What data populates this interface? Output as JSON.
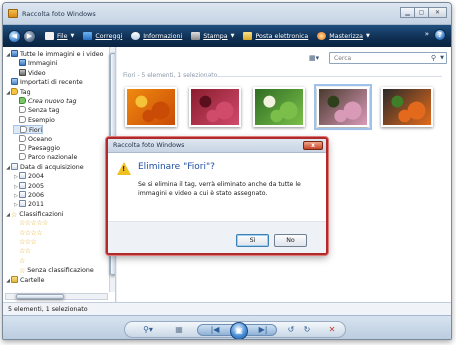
{
  "window": {
    "title": "Raccolta foto Windows"
  },
  "toolbar": {
    "items": [
      {
        "label": "File",
        "icon": "file-icon"
      },
      {
        "label": "Correggi",
        "icon": "fix-icon"
      },
      {
        "label": "Informazioni",
        "icon": "info-icon"
      },
      {
        "label": "Stampa",
        "icon": "print-icon"
      },
      {
        "label": "Posta elettronica",
        "icon": "mail-icon"
      },
      {
        "label": "Masterizza",
        "icon": "burn-icon"
      }
    ],
    "more": "»",
    "help": "?"
  },
  "sidebar": {
    "rows": [
      {
        "label": "Tutte le immagini e i video",
        "exp": "◢",
        "icon": "ico-photo"
      },
      {
        "label": "Immagini",
        "exp": "",
        "icon": "ico-photo"
      },
      {
        "label": "Video",
        "exp": "",
        "icon": "ico-video"
      },
      {
        "label": "Importati di recente",
        "exp": "",
        "icon": "ico-recent"
      },
      {
        "label": "Tag",
        "exp": "◢",
        "icon": "ico-tag"
      },
      {
        "label": "Crea nuovo tag",
        "exp": "",
        "icon": "ico-tag-new",
        "italic": true
      },
      {
        "label": "Senza tag",
        "exp": "",
        "icon": "ico-tag-empty"
      },
      {
        "label": "Esempio",
        "exp": "",
        "icon": "ico-tag-empty"
      },
      {
        "label": "Fiori",
        "exp": "",
        "icon": "ico-tag-empty",
        "selected": true
      },
      {
        "label": "Oceano",
        "exp": "",
        "icon": "ico-tag-empty"
      },
      {
        "label": "Paesaggio",
        "exp": "",
        "icon": "ico-tag-empty"
      },
      {
        "label": "Parco nazionale",
        "exp": "",
        "icon": "ico-tag-empty"
      },
      {
        "label": "Data di acquisizione",
        "exp": "◢",
        "icon": "ico-cal"
      },
      {
        "label": "2004",
        "exp": "▷",
        "icon": "ico-cal"
      },
      {
        "label": "2005",
        "exp": "▷",
        "icon": "ico-cal"
      },
      {
        "label": "2006",
        "exp": "▷",
        "icon": "ico-cal"
      },
      {
        "label": "2011",
        "exp": "▷",
        "icon": "ico-cal"
      },
      {
        "label": "Classificazioni",
        "exp": "◢",
        "icon": "ico-star"
      },
      {
        "label": "",
        "exp": "",
        "stars": 5
      },
      {
        "label": "",
        "exp": "",
        "stars": 4
      },
      {
        "label": "",
        "exp": "",
        "stars": 3
      },
      {
        "label": "",
        "exp": "",
        "stars": 2
      },
      {
        "label": "",
        "exp": "",
        "stars": 1
      },
      {
        "label": "Senza classificazione",
        "exp": "",
        "icon": "ico-star",
        "outline": true
      },
      {
        "label": "Cartelle",
        "exp": "◢",
        "icon": "ico-folder"
      }
    ]
  },
  "content": {
    "search_placeholder": "Cerca",
    "group_header": "Fiori - 5 elementi, 1 selezionato",
    "thumbnails": [
      {
        "name": "thumb-orange-flowers",
        "c1": "#f08a10",
        "c2": "#c94b06",
        "c3": "#f5c33a",
        "selected": false
      },
      {
        "name": "thumb-red-flowers",
        "c1": "#8a1d2e",
        "c2": "#d04a6a",
        "c3": "#5a0f1c",
        "selected": false
      },
      {
        "name": "thumb-green-flower",
        "c1": "#2f6d23",
        "c2": "#7bbf4a",
        "c3": "#f2f2e0",
        "selected": false
      },
      {
        "name": "thumb-pink-flowers",
        "c1": "#4a3a2e",
        "c2": "#d99ab8",
        "c3": "#2e3f1c",
        "selected": true
      },
      {
        "name": "thumb-video-flower",
        "c1": "#2a2a2a",
        "c2": "#e36a1c",
        "c3": "#3f7f2a",
        "selected": false
      }
    ]
  },
  "dialog": {
    "title": "Raccolta foto Windows",
    "close": "x",
    "heading": "Eliminare \"Fiori\"?",
    "text": "Se si elimina il tag, verrà eliminato anche da tutte le immagini e video a cui è stato assegnato.",
    "yes": "Sì",
    "no": "No"
  },
  "status": {
    "text": "5 elementi, 1 selezionato"
  },
  "bottombar": {
    "zoom": "⚲▾",
    "grid": "▦",
    "prev": "|◀",
    "play": "▣",
    "next": "▶|",
    "rotate_left": "↺",
    "rotate_right": "↻",
    "delete": "✕"
  }
}
